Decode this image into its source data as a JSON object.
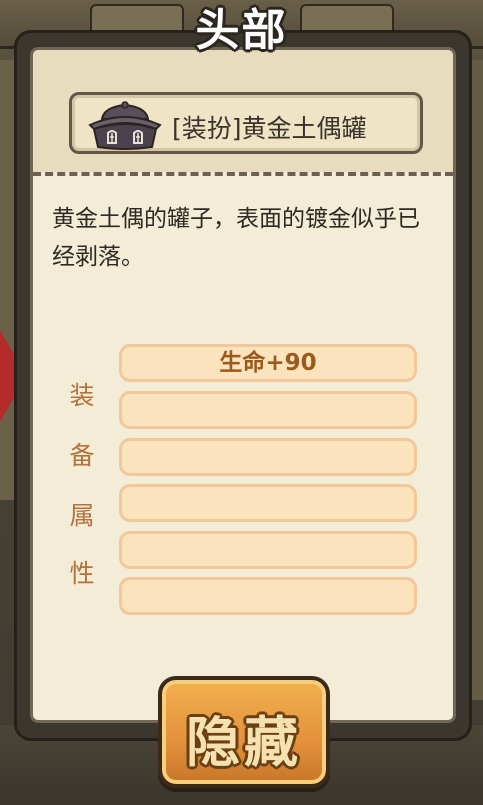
{
  "title": "头部",
  "item": {
    "name": "[装扮]黄金土偶罐",
    "icon": "clay-pot-icon",
    "description": "黄金土偶的罐子，表面的镀金似乎已经剥落。"
  },
  "attributes": {
    "label_chars": [
      "装",
      "备",
      "属",
      "性"
    ],
    "rows": [
      "生命+90",
      "",
      "",
      "",
      "",
      ""
    ]
  },
  "buttons": {
    "hide_label": "隐藏"
  },
  "colors": {
    "panel_bg": "#f3ecd6",
    "label_color": "#b4713a",
    "attr_text": "#9b5a1c",
    "attr_fill": "#fbe3be",
    "button_fill": "#e3913b"
  }
}
